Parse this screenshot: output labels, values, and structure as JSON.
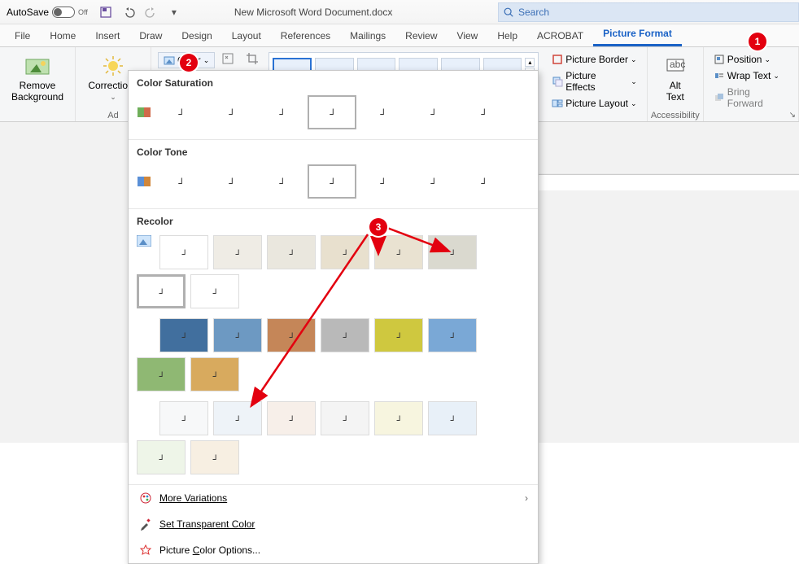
{
  "titlebar": {
    "autosave_label": "AutoSave",
    "autosave_state": "Off",
    "document_name": "New Microsoft Word Document.docx",
    "search_placeholder": "Search"
  },
  "tabs": [
    "File",
    "Home",
    "Insert",
    "Draw",
    "Design",
    "Layout",
    "References",
    "Mailings",
    "Review",
    "View",
    "Help",
    "ACROBAT",
    "Picture Format"
  ],
  "active_tab": "Picture Format",
  "ribbon": {
    "remove_background": "Remove\nBackground",
    "corrections": "Corrections",
    "color_label": "Color",
    "adjust_group": "Ad",
    "picture_border": "Picture Border",
    "picture_effects": "Picture Effects",
    "picture_layout": "Picture Layout",
    "alt_text": "Alt\nText",
    "accessibility_group": "Accessibility",
    "position": "Position",
    "wrap_text": "Wrap Text",
    "bring_forward": "Bring Forward"
  },
  "dropdown": {
    "saturation_header": "Color Saturation",
    "tone_header": "Color Tone",
    "recolor_header": "Recolor",
    "more_variations": "More Variations",
    "set_transparent": "Set Transparent Color",
    "picture_color_options": "Picture Color Options...",
    "recolor_colors": [
      [
        "#ffffff",
        "#efece5",
        "#eae7de",
        "#e8e0ce",
        "#e9e2d1",
        "#dad9cf",
        "#ffffff",
        "#ffffff"
      ],
      [
        "#416f9e",
        "#6d99c2",
        "#c58658",
        "#b9b9b9",
        "#cfc83f",
        "#7aa8d6",
        "#8fb873",
        "#d8aa5e"
      ],
      [
        "#f7f8f9",
        "#eef3f8",
        "#f7efe9",
        "#f4f4f4",
        "#f7f5df",
        "#e8f0f8",
        "#eef5e8",
        "#f7efe2"
      ]
    ]
  },
  "annotations": {
    "b1": "1",
    "b2": "2",
    "b3": "3"
  }
}
